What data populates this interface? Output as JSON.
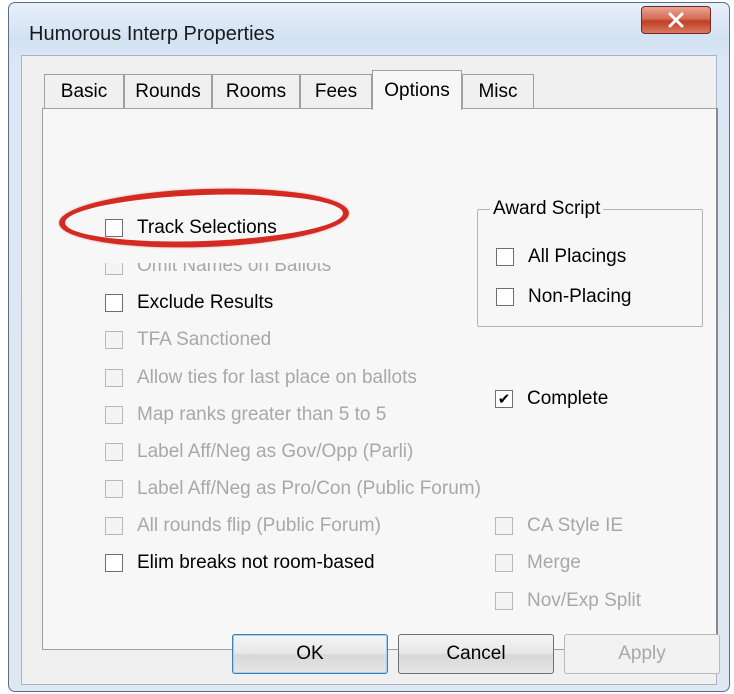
{
  "window": {
    "title": "Humorous Interp Properties"
  },
  "tabs": [
    {
      "label": "Basic"
    },
    {
      "label": "Rounds"
    },
    {
      "label": "Rooms"
    },
    {
      "label": "Fees"
    },
    {
      "label": "Options",
      "active": true
    },
    {
      "label": "Misc"
    }
  ],
  "options": {
    "track_selections": {
      "label": "Track Selections",
      "checked": false,
      "enabled": true
    },
    "omit_names": {
      "label": "Omit Names on Ballots",
      "checked": false,
      "enabled": false
    },
    "exclude_results": {
      "label": "Exclude Results",
      "checked": false,
      "enabled": true
    },
    "tfa_sanctioned": {
      "label": "TFA Sanctioned",
      "checked": false,
      "enabled": false
    },
    "allow_ties": {
      "label": "Allow ties for last place on ballots",
      "checked": false,
      "enabled": false
    },
    "map_ranks": {
      "label": "Map ranks greater than 5 to 5",
      "checked": false,
      "enabled": false
    },
    "label_gov_opp": {
      "label": "Label Aff/Neg as Gov/Opp (Parli)",
      "checked": false,
      "enabled": false
    },
    "label_pro_con": {
      "label": "Label Aff/Neg as Pro/Con (Public Forum)",
      "checked": false,
      "enabled": false
    },
    "all_rounds_flip": {
      "label": "All rounds flip (Public Forum)",
      "checked": false,
      "enabled": false
    },
    "elim_breaks": {
      "label": "Elim breaks not room-based",
      "checked": false,
      "enabled": true
    }
  },
  "award_script": {
    "label": "Award Script",
    "all_placings": {
      "label": "All Placings",
      "checked": false
    },
    "non_placing": {
      "label": "Non-Placing",
      "checked": false
    }
  },
  "complete": {
    "label": "Complete",
    "checked": true,
    "check_glyph": "✔"
  },
  "right_options": {
    "ca_style_ie": {
      "label": "CA Style IE",
      "enabled": false
    },
    "merge": {
      "label": "Merge",
      "enabled": false
    },
    "nov_exp_split": {
      "label": "Nov/Exp Split",
      "enabled": false
    }
  },
  "buttons": {
    "ok": "OK",
    "cancel": "Cancel",
    "apply": "Apply"
  },
  "colors": {
    "highlight_ellipse": "#d42a22",
    "close_button": "#c03f27"
  },
  "icons": {
    "close": "close-icon"
  }
}
